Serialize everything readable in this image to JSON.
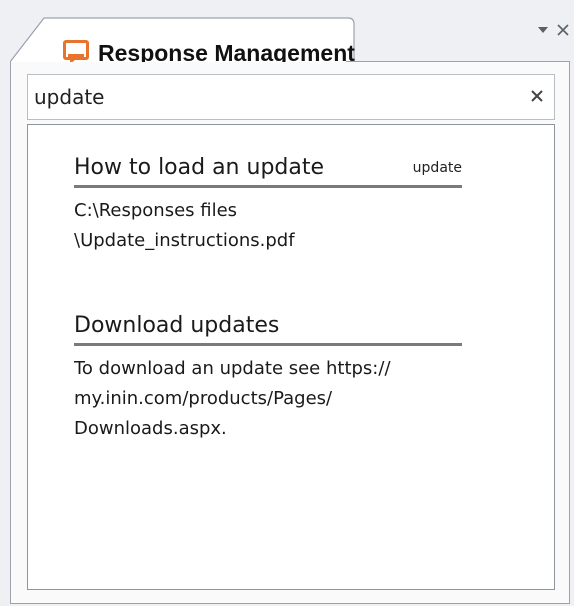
{
  "pane": {
    "tab_title": "Response Management",
    "tab_icon": "response-management-icon",
    "actions": {
      "dropdown_icon": "chevron-down-icon",
      "close_icon": "close-icon"
    }
  },
  "search": {
    "value": "update",
    "clear_icon": "close-icon"
  },
  "results": [
    {
      "title": "How to load an update",
      "keyword": "update",
      "body": "C:\\Responses files\n\\Update_instructions.pdf"
    },
    {
      "title": "Download updates",
      "keyword": "",
      "body": "To download an update see https://\nmy.inin.com/products/Pages/\nDownloads.aspx."
    }
  ],
  "colors": {
    "icon_orange": "#e8742c",
    "tab_border": "#9aa3ad",
    "background": "#eef0f3"
  }
}
